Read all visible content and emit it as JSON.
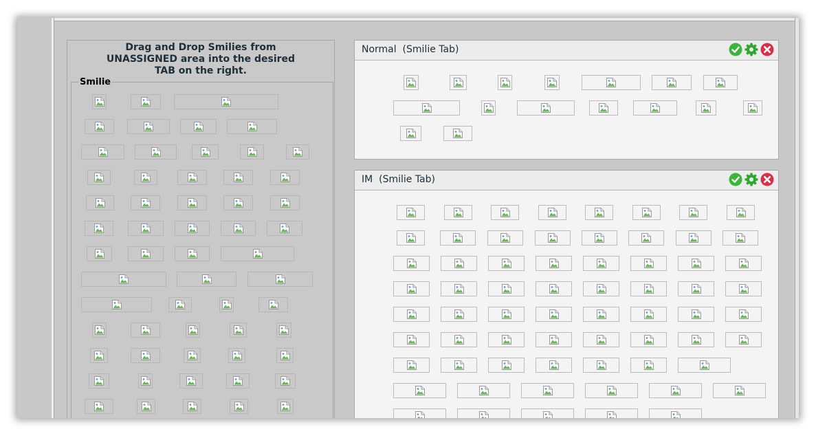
{
  "instructions": {
    "line1": "Drag and Drop Smilies from",
    "line2": "UNASSIGNED area into the desired",
    "line3": "TAB on the right."
  },
  "unassigned": {
    "legend": "Smilie"
  },
  "tabs": [
    {
      "id": "normal",
      "title": "Normal  (Smilie Tab)",
      "actions": [
        "check-circle-icon",
        "gear-icon",
        "close-circle-icon"
      ]
    },
    {
      "id": "im",
      "title": "IM  (Smilie Tab)",
      "actions": [
        "check-circle-icon",
        "gear-icon",
        "close-circle-icon"
      ]
    }
  ],
  "icons": {
    "smilie": "broken-image-icon"
  },
  "colors": {
    "confirm": "#3cb53c",
    "settings": "#2ea82e",
    "delete": "#d9304a"
  }
}
